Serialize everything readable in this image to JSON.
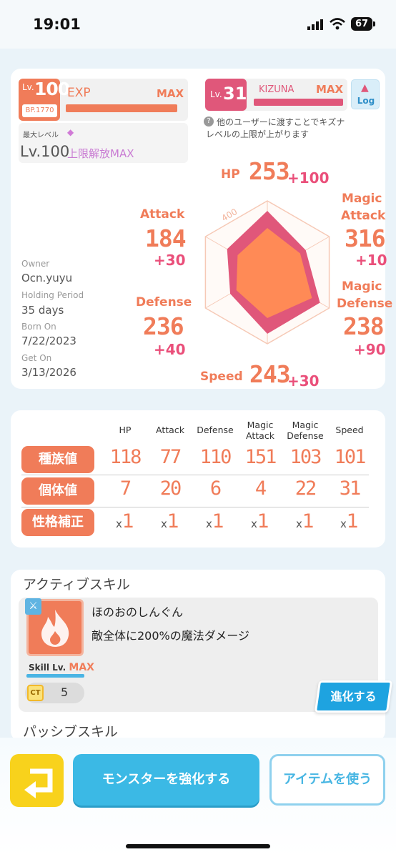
{
  "status": {
    "time": "19:01",
    "battery": "67"
  },
  "level": {
    "lv_prefix": "Lv.",
    "lv": "100",
    "bp": "BP.1770",
    "exp_label": "EXP",
    "exp_max": "MAX",
    "max_level_label": "最大レベル",
    "max_level": "Lv.100",
    "limit_break": "上限解放MAX"
  },
  "kizuna": {
    "lv_prefix": "Lv.",
    "lv": "31",
    "label": "KIZUNA",
    "max": "MAX",
    "log": "Log",
    "note_line1": "他のユーザーに渡すことでキズナ",
    "note_line2": "レベルの上限が上がります"
  },
  "owner": {
    "owner_label": "Owner",
    "owner": "Ocn.yuyu",
    "holding_label": "Holding Period",
    "holding": "35 days",
    "born_label": "Born On",
    "born": "7/22/2023",
    "get_label": "Get On",
    "get": "3/13/2026"
  },
  "radar": {
    "scale_label": "400",
    "hp": {
      "label": "HP",
      "value": "253",
      "bonus": "+100"
    },
    "attack": {
      "label": "Attack",
      "value": "184",
      "bonus": "+30"
    },
    "magic_attack": {
      "label_1": "Magic",
      "label_2": "Attack",
      "value": "316",
      "bonus": "+10"
    },
    "defense": {
      "label": "Defense",
      "value": "236",
      "bonus": "+40"
    },
    "magic_defense": {
      "label_1": "Magic",
      "label_2": "Defense",
      "value": "238",
      "bonus": "+90"
    },
    "speed": {
      "label": "Speed",
      "value": "243",
      "bonus": "+30"
    },
    "max": 400,
    "base_fraction": [
      0.62,
      0.53,
      0.72,
      0.64,
      0.5,
      0.48
    ],
    "total_fraction": [
      0.86,
      0.62,
      0.85,
      0.86,
      0.6,
      0.65
    ],
    "colors": {
      "total": "#e0577a",
      "base": "#ff8a56",
      "grid": "#f6c9b6"
    }
  },
  "stats_table": {
    "headers": [
      "HP",
      "Attack",
      "Defense",
      "Magic Attack",
      "Magic Defense",
      "Speed"
    ],
    "rows": [
      {
        "label": "種族値",
        "values": [
          "118",
          "77",
          "110",
          "151",
          "103",
          "101"
        ]
      },
      {
        "label": "個体値",
        "values": [
          "7",
          "20",
          "6",
          "4",
          "22",
          "31"
        ]
      },
      {
        "label": "性格補正",
        "values": [
          "1",
          "1",
          "1",
          "1",
          "1",
          "1"
        ]
      }
    ],
    "x_prefix": "x"
  },
  "active_skill": {
    "section": "アクティブスキル",
    "name": "ほのおのしんぐん",
    "desc": "敵全体に200%の魔法ダメージ",
    "skill_lv_label": "Skill Lv.",
    "skill_lv": "MAX",
    "ct_label": "CT",
    "ct": "5",
    "evolve": "進化する",
    "icon": "fire-icon"
  },
  "passive_skill": {
    "section": "パッシブスキル"
  },
  "bottom": {
    "back_icon": "back-arrow-icon",
    "enhance": "モンスターを強化する",
    "use_item": "アイテムを使う"
  }
}
